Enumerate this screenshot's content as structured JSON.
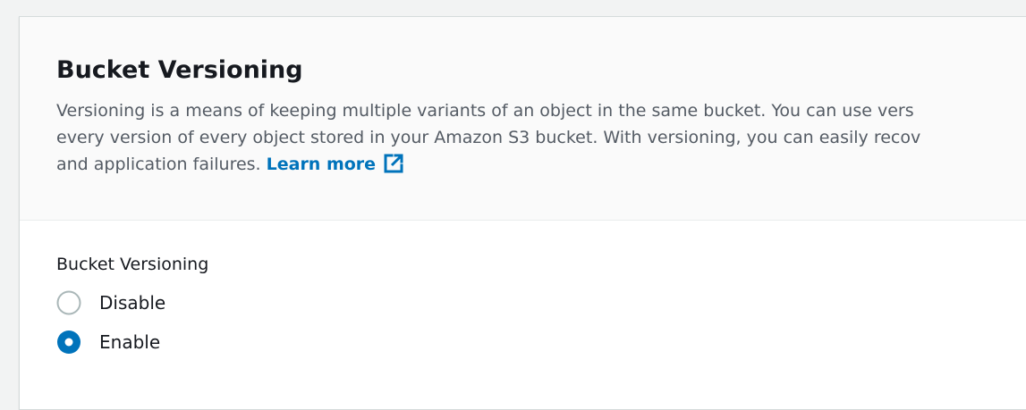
{
  "section": {
    "title": "Bucket Versioning",
    "description_lines": [
      "Versioning is a means of keeping multiple variants of an object in the same bucket. You can use vers",
      "every version of every object stored in your Amazon S3 bucket. With versioning, you can easily recov",
      "and application failures. "
    ],
    "learn_more_label": "Learn more",
    "learn_more_icon": "external-link-icon"
  },
  "field": {
    "label": "Bucket Versioning",
    "options": [
      {
        "label": "Disable",
        "selected": false
      },
      {
        "label": "Enable",
        "selected": true
      }
    ]
  },
  "colors": {
    "accent": "#0073bb",
    "radio_unselected_border": "#aab7b8",
    "panel_background": "#ffffff",
    "header_background": "#fafafa",
    "page_background": "#f2f3f3"
  }
}
